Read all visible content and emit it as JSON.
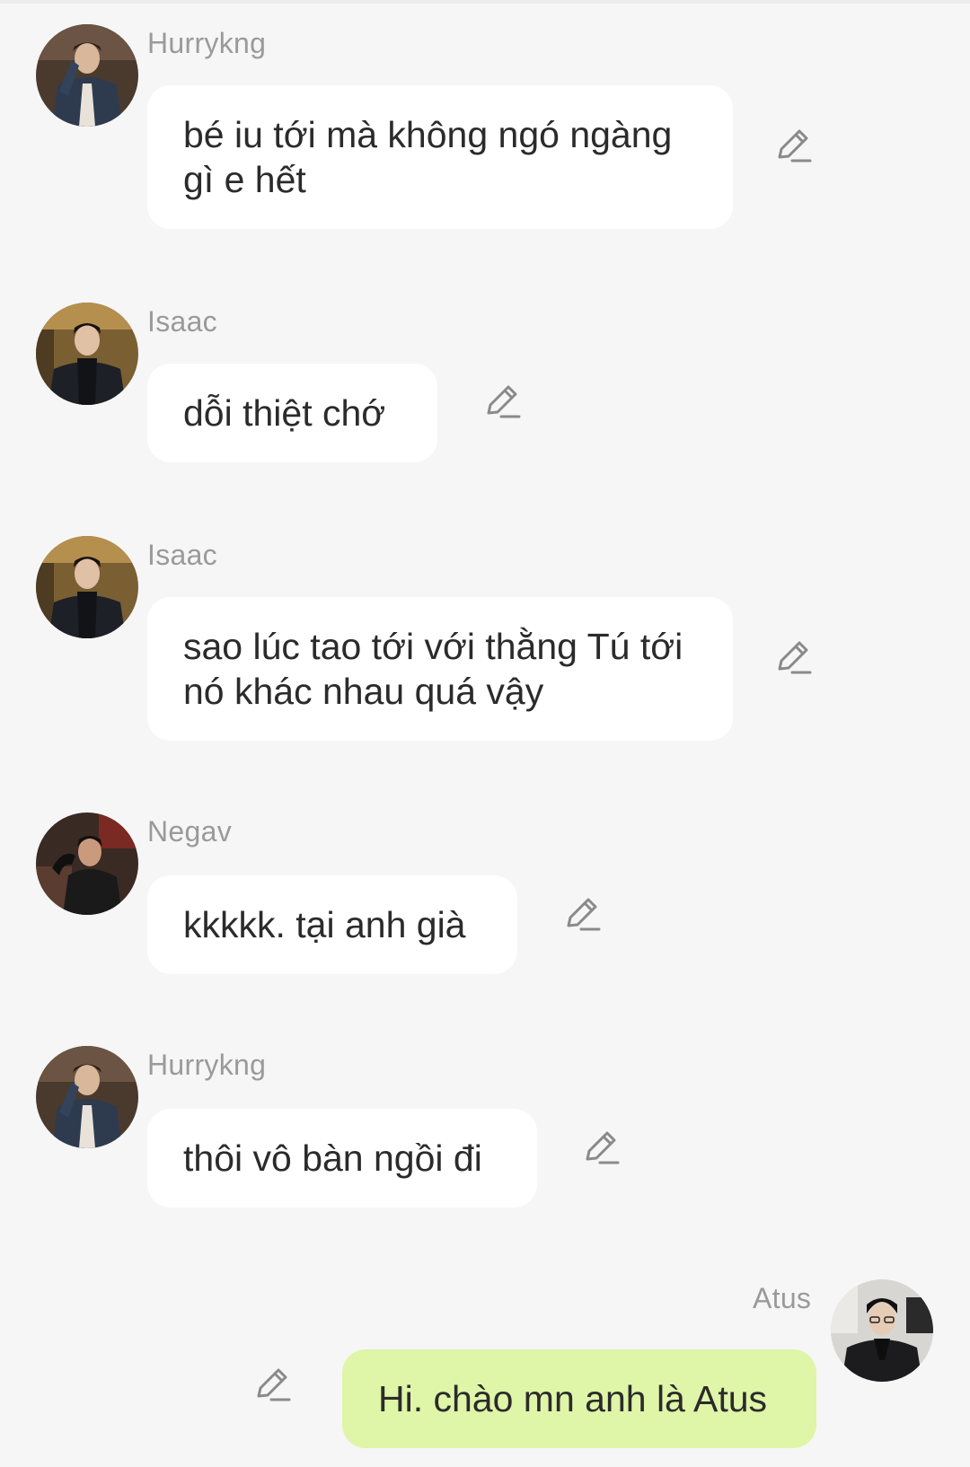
{
  "messages": [
    {
      "sender": "Hurrykng",
      "text_lines": [
        "bé iu tới mà không ngó ngàng",
        "gì e hết"
      ],
      "outgoing": false
    },
    {
      "sender": "Isaac",
      "text_lines": [
        "dỗi thiệt chớ"
      ],
      "outgoing": false
    },
    {
      "sender": "Isaac",
      "text_lines": [
        "sao lúc tao tới với thằng Tú tới",
        "nó khác nhau quá vậy"
      ],
      "outgoing": false
    },
    {
      "sender": "Negav",
      "text_lines": [
        "kkkkk. tại anh già"
      ],
      "outgoing": false
    },
    {
      "sender": "Hurrykng",
      "text_lines": [
        "thôi vô bàn ngồi đi"
      ],
      "outgoing": false
    },
    {
      "sender": "Atus",
      "text_lines": [
        "Hi. chào mn anh là Atus"
      ],
      "outgoing": true
    }
  ],
  "icons": {
    "edit": "pencil-edit-icon"
  },
  "colors": {
    "background": "#f6f6f6",
    "incoming_bubble": "#ffffff",
    "outgoing_bubble": "#dff5a8",
    "sender_name": "#9a9a9a",
    "message_text": "#2b2b2b"
  }
}
